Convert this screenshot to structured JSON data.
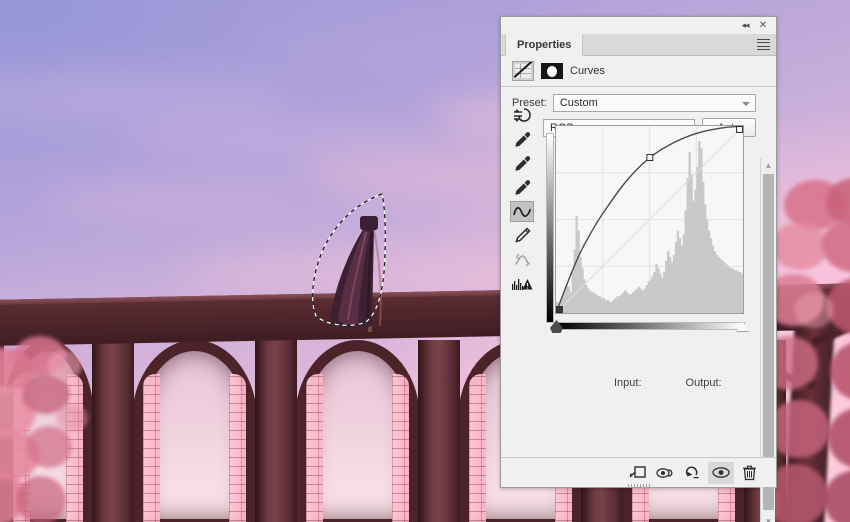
{
  "panel": {
    "tab_label": "Properties",
    "collapse_icon": "double-chevron-left-icon",
    "close_icon": "close-icon",
    "menu_icon": "panel-menu-icon",
    "adjustment_title": "Curves",
    "adjustment_icon": "curves-adjustment-icon",
    "mask_icon": "layer-mask-thumbnail-icon"
  },
  "controls": {
    "preset_label": "Preset:",
    "preset_value": "Custom",
    "channel_value": "RGB",
    "auto_label": "Auto",
    "input_label": "Input:",
    "output_label": "Output:",
    "input_value": "",
    "output_value": ""
  },
  "tools": [
    {
      "name": "target-adjustment-tool-icon",
      "active": false
    },
    {
      "name": "black-point-eyedropper-icon",
      "active": false
    },
    {
      "name": "gray-point-eyedropper-icon",
      "active": false
    },
    {
      "name": "white-point-eyedropper-icon",
      "active": false
    },
    {
      "name": "curve-edit-tool-icon",
      "active": true
    },
    {
      "name": "pencil-draw-curve-tool-icon",
      "active": false
    },
    {
      "name": "smooth-curve-tool-icon",
      "active": false
    },
    {
      "name": "histogram-warning-icon",
      "active": false
    }
  ],
  "footer_buttons": [
    {
      "name": "clip-to-layer-icon",
      "active": false
    },
    {
      "name": "view-previous-state-icon",
      "active": false
    },
    {
      "name": "reset-adjustment-icon",
      "active": false
    },
    {
      "name": "toggle-layer-visibility-icon",
      "active": true
    },
    {
      "name": "delete-adjustment-layer-icon",
      "active": false
    }
  ],
  "scrollbar": {
    "up_arrow": "chevron-up-icon",
    "down_arrow": "chevron-down-icon"
  },
  "chart_data": {
    "type": "line",
    "title": "Curves",
    "xlabel": "Input",
    "ylabel": "Output",
    "xlim": [
      0,
      255
    ],
    "ylim": [
      0,
      255
    ],
    "grid": true,
    "channel": "RGB",
    "control_points": [
      {
        "input": 0,
        "output": 0
      },
      {
        "input": 128,
        "output": 212
      },
      {
        "input": 255,
        "output": 255
      }
    ],
    "curve_points": [
      {
        "input": 0,
        "output": 0
      },
      {
        "input": 16,
        "output": 42
      },
      {
        "input": 32,
        "output": 80
      },
      {
        "input": 48,
        "output": 110
      },
      {
        "input": 64,
        "output": 136
      },
      {
        "input": 96,
        "output": 180
      },
      {
        "input": 128,
        "output": 212
      },
      {
        "input": 160,
        "output": 232
      },
      {
        "input": 192,
        "output": 245
      },
      {
        "input": 224,
        "output": 252
      },
      {
        "input": 255,
        "output": 255
      }
    ],
    "baseline": "identity-diagonal",
    "histogram": [
      6,
      5,
      7,
      9,
      12,
      15,
      14,
      11,
      22,
      34,
      52,
      44,
      30,
      24,
      18,
      15,
      13,
      12,
      11,
      11,
      10,
      9,
      9,
      8,
      8,
      7,
      7,
      6,
      6,
      7,
      8,
      9,
      9,
      10,
      11,
      12,
      11,
      10,
      10,
      11,
      12,
      13,
      14,
      13,
      12,
      13,
      15,
      17,
      18,
      20,
      22,
      26,
      24,
      21,
      19,
      22,
      28,
      33,
      30,
      27,
      31,
      38,
      44,
      40,
      36,
      42,
      55,
      72,
      86,
      74,
      60,
      66,
      78,
      92,
      88,
      70,
      58,
      50,
      44,
      40,
      36,
      33,
      31,
      30,
      29,
      28,
      27,
      26,
      25,
      24,
      24,
      23,
      23,
      22,
      22,
      21
    ],
    "endpoint_black": {
      "input": 0,
      "label": "black-point-slider"
    },
    "endpoint_white": {
      "input": 255,
      "label": "white-point-slider"
    }
  },
  "canvas": {
    "description": "stone-viaduct-at-sunset-with-cherry-blossoms",
    "selection": "marching-ants-selection-around-banner",
    "sky_top_color": "#a79ad8",
    "sky_bottom_color": "#fbd3dd",
    "stone_color": "#4a2329",
    "brick_highlight_color": "#ffc8d7",
    "blossom_color": "#e8849b"
  }
}
